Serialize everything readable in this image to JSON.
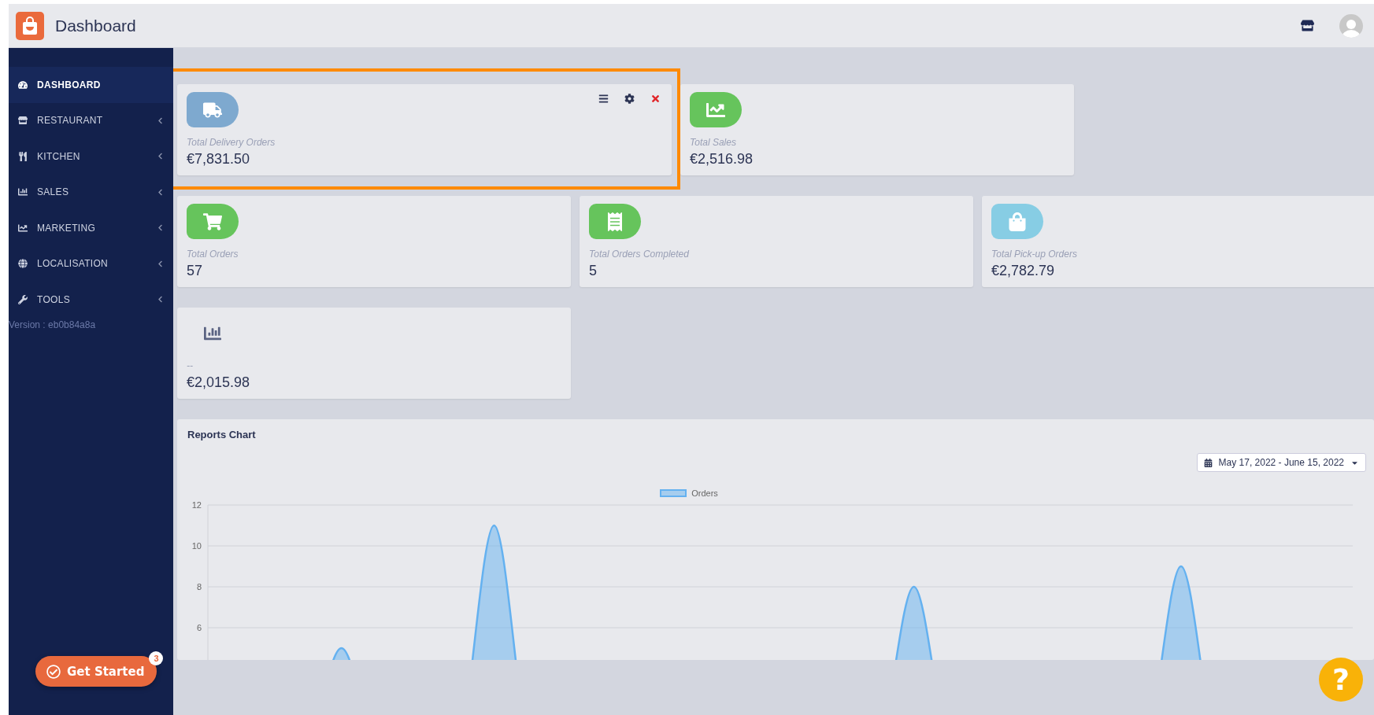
{
  "header": {
    "title": "Dashboard"
  },
  "sidebar": {
    "items": [
      {
        "label": "DASHBOARD",
        "selected": true,
        "expandable": false
      },
      {
        "label": "RESTAURANT",
        "selected": false,
        "expandable": true
      },
      {
        "label": "KITCHEN",
        "selected": false,
        "expandable": true
      },
      {
        "label": "SALES",
        "selected": false,
        "expandable": true
      },
      {
        "label": "MARKETING",
        "selected": false,
        "expandable": true
      },
      {
        "label": "LOCALISATION",
        "selected": false,
        "expandable": true
      },
      {
        "label": "TOOLS",
        "selected": false,
        "expandable": true
      }
    ],
    "version": "Version : eb0b84a8a"
  },
  "stat_rows": [
    {
      "cards": [
        {
          "label": "Total Delivery Orders",
          "value": "€7,831.50",
          "color": "#7ea9cf",
          "highlighted": true,
          "toolbar": true
        },
        {
          "label": "Total Sales",
          "value": "€2,516.98",
          "color": "#66c45c",
          "highlighted": false,
          "toolbar": false
        }
      ]
    },
    {
      "cards": [
        {
          "label": "Total Orders",
          "value": "57",
          "color": "#66c45c",
          "highlighted": false,
          "toolbar": false
        },
        {
          "label": "Total Orders Completed",
          "value": "5",
          "color": "#66c45c",
          "highlighted": false,
          "toolbar": false
        },
        {
          "label": "Total Pick-up Orders",
          "value": "€2,782.79",
          "color": "#87cde4",
          "highlighted": false,
          "toolbar": false
        }
      ]
    },
    {
      "cards": [
        {
          "label": "--",
          "value": "€2,015.98",
          "highlighted": false,
          "toolbar": false
        }
      ]
    }
  ],
  "reports": {
    "title": "Reports Chart",
    "date_range": "May 17, 2022 - June 15, 2022",
    "chart_data": {
      "type": "area",
      "grid": true,
      "ylim": [
        0,
        12
      ],
      "yticks": [
        6,
        8,
        10,
        12
      ],
      "series": [
        {
          "name": "Orders",
          "color": "#64b1f0",
          "values": [
            0,
            0,
            0,
            5,
            0,
            0,
            0,
            11,
            0,
            0,
            0,
            0,
            0,
            0,
            0,
            0,
            0,
            0,
            8,
            0,
            0,
            0,
            0,
            0,
            0,
            9,
            0,
            0,
            0,
            0
          ]
        }
      ]
    }
  },
  "get_started": {
    "label": "Get Started",
    "badge": "3"
  },
  "help_button": {
    "label": "?"
  }
}
